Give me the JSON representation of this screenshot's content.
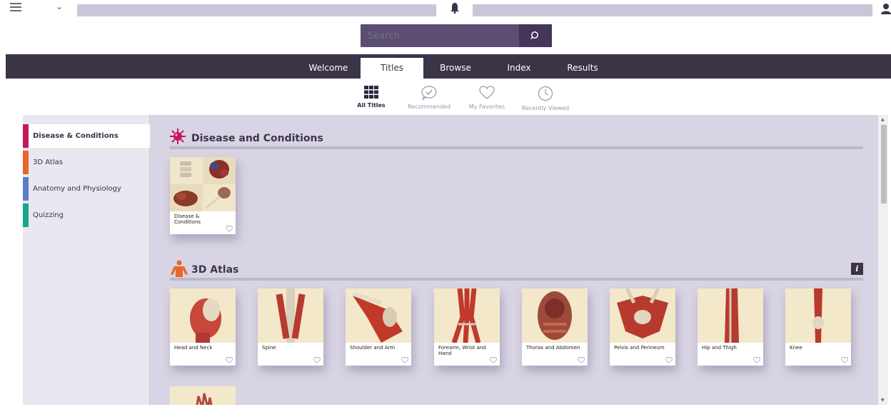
{
  "search": {
    "placeholder": "Search"
  },
  "nav": {
    "tabs": [
      "Welcome",
      "Titles",
      "Browse",
      "Index",
      "Results"
    ],
    "active": "Titles"
  },
  "subtabs": [
    "All Titles",
    "Recommended",
    "My Favorites",
    "Recently Viewed"
  ],
  "sidebar": {
    "items": [
      {
        "label": "Disease & Conditions",
        "color": "#c2185b"
      },
      {
        "label": "3D Atlas",
        "color": "#e8662a"
      },
      {
        "label": "Anatomy and Physiology",
        "color": "#5b7fc7"
      },
      {
        "label": "Quizzing",
        "color": "#16a58a"
      }
    ]
  },
  "sections": {
    "disease": {
      "title": "Disease and Conditions",
      "icon_color": "#c2185b",
      "cards": [
        "Disease &\nConditions"
      ]
    },
    "atlas": {
      "title": "3D Atlas",
      "icon_color": "#e8662a",
      "info": "i",
      "cards": [
        "Head and Neck",
        "Spine",
        "Shoulder and Arm",
        "Forearm, Wrist and Hand",
        "Thorax and Abdomen",
        "Pelvis and Perineum",
        "Hip and Thigh",
        "Knee"
      ]
    }
  },
  "colors": {
    "nav_bg": "#3b3447",
    "search_bg": "#5c4e73",
    "content_bg": "#d8d4e3"
  }
}
